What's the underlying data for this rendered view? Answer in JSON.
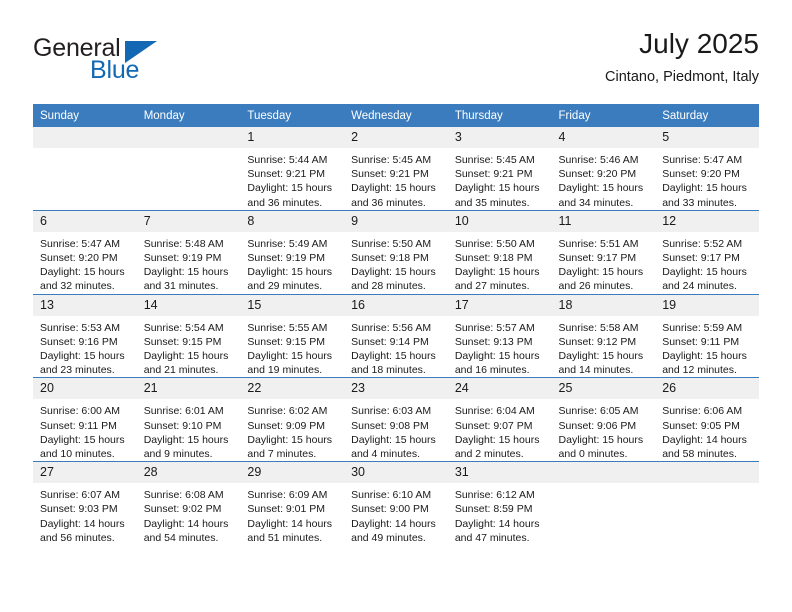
{
  "brand": {
    "name_part1": "General",
    "name_part2": "Blue",
    "accent_color": "#1268b3"
  },
  "header": {
    "title": "July 2025",
    "subtitle": "Cintano, Piedmont, Italy"
  },
  "calendar": {
    "header_color": "#3b7cbe",
    "daynum_band_color": "#f0f0f0",
    "weekday_headers": [
      "Sunday",
      "Monday",
      "Tuesday",
      "Wednesday",
      "Thursday",
      "Friday",
      "Saturday"
    ],
    "weeks": [
      [
        {
          "day": "",
          "lines": []
        },
        {
          "day": "",
          "lines": []
        },
        {
          "day": "1",
          "lines": [
            "Sunrise: 5:44 AM",
            "Sunset: 9:21 PM",
            "Daylight: 15 hours",
            "and 36 minutes."
          ]
        },
        {
          "day": "2",
          "lines": [
            "Sunrise: 5:45 AM",
            "Sunset: 9:21 PM",
            "Daylight: 15 hours",
            "and 36 minutes."
          ]
        },
        {
          "day": "3",
          "lines": [
            "Sunrise: 5:45 AM",
            "Sunset: 9:21 PM",
            "Daylight: 15 hours",
            "and 35 minutes."
          ]
        },
        {
          "day": "4",
          "lines": [
            "Sunrise: 5:46 AM",
            "Sunset: 9:20 PM",
            "Daylight: 15 hours",
            "and 34 minutes."
          ]
        },
        {
          "day": "5",
          "lines": [
            "Sunrise: 5:47 AM",
            "Sunset: 9:20 PM",
            "Daylight: 15 hours",
            "and 33 minutes."
          ]
        }
      ],
      [
        {
          "day": "6",
          "lines": [
            "Sunrise: 5:47 AM",
            "Sunset: 9:20 PM",
            "Daylight: 15 hours",
            "and 32 minutes."
          ]
        },
        {
          "day": "7",
          "lines": [
            "Sunrise: 5:48 AM",
            "Sunset: 9:19 PM",
            "Daylight: 15 hours",
            "and 31 minutes."
          ]
        },
        {
          "day": "8",
          "lines": [
            "Sunrise: 5:49 AM",
            "Sunset: 9:19 PM",
            "Daylight: 15 hours",
            "and 29 minutes."
          ]
        },
        {
          "day": "9",
          "lines": [
            "Sunrise: 5:50 AM",
            "Sunset: 9:18 PM",
            "Daylight: 15 hours",
            "and 28 minutes."
          ]
        },
        {
          "day": "10",
          "lines": [
            "Sunrise: 5:50 AM",
            "Sunset: 9:18 PM",
            "Daylight: 15 hours",
            "and 27 minutes."
          ]
        },
        {
          "day": "11",
          "lines": [
            "Sunrise: 5:51 AM",
            "Sunset: 9:17 PM",
            "Daylight: 15 hours",
            "and 26 minutes."
          ]
        },
        {
          "day": "12",
          "lines": [
            "Sunrise: 5:52 AM",
            "Sunset: 9:17 PM",
            "Daylight: 15 hours",
            "and 24 minutes."
          ]
        }
      ],
      [
        {
          "day": "13",
          "lines": [
            "Sunrise: 5:53 AM",
            "Sunset: 9:16 PM",
            "Daylight: 15 hours",
            "and 23 minutes."
          ]
        },
        {
          "day": "14",
          "lines": [
            "Sunrise: 5:54 AM",
            "Sunset: 9:15 PM",
            "Daylight: 15 hours",
            "and 21 minutes."
          ]
        },
        {
          "day": "15",
          "lines": [
            "Sunrise: 5:55 AM",
            "Sunset: 9:15 PM",
            "Daylight: 15 hours",
            "and 19 minutes."
          ]
        },
        {
          "day": "16",
          "lines": [
            "Sunrise: 5:56 AM",
            "Sunset: 9:14 PM",
            "Daylight: 15 hours",
            "and 18 minutes."
          ]
        },
        {
          "day": "17",
          "lines": [
            "Sunrise: 5:57 AM",
            "Sunset: 9:13 PM",
            "Daylight: 15 hours",
            "and 16 minutes."
          ]
        },
        {
          "day": "18",
          "lines": [
            "Sunrise: 5:58 AM",
            "Sunset: 9:12 PM",
            "Daylight: 15 hours",
            "and 14 minutes."
          ]
        },
        {
          "day": "19",
          "lines": [
            "Sunrise: 5:59 AM",
            "Sunset: 9:11 PM",
            "Daylight: 15 hours",
            "and 12 minutes."
          ]
        }
      ],
      [
        {
          "day": "20",
          "lines": [
            "Sunrise: 6:00 AM",
            "Sunset: 9:11 PM",
            "Daylight: 15 hours",
            "and 10 minutes."
          ]
        },
        {
          "day": "21",
          "lines": [
            "Sunrise: 6:01 AM",
            "Sunset: 9:10 PM",
            "Daylight: 15 hours",
            "and 9 minutes."
          ]
        },
        {
          "day": "22",
          "lines": [
            "Sunrise: 6:02 AM",
            "Sunset: 9:09 PM",
            "Daylight: 15 hours",
            "and 7 minutes."
          ]
        },
        {
          "day": "23",
          "lines": [
            "Sunrise: 6:03 AM",
            "Sunset: 9:08 PM",
            "Daylight: 15 hours",
            "and 4 minutes."
          ]
        },
        {
          "day": "24",
          "lines": [
            "Sunrise: 6:04 AM",
            "Sunset: 9:07 PM",
            "Daylight: 15 hours",
            "and 2 minutes."
          ]
        },
        {
          "day": "25",
          "lines": [
            "Sunrise: 6:05 AM",
            "Sunset: 9:06 PM",
            "Daylight: 15 hours",
            "and 0 minutes."
          ]
        },
        {
          "day": "26",
          "lines": [
            "Sunrise: 6:06 AM",
            "Sunset: 9:05 PM",
            "Daylight: 14 hours",
            "and 58 minutes."
          ]
        }
      ],
      [
        {
          "day": "27",
          "lines": [
            "Sunrise: 6:07 AM",
            "Sunset: 9:03 PM",
            "Daylight: 14 hours",
            "and 56 minutes."
          ]
        },
        {
          "day": "28",
          "lines": [
            "Sunrise: 6:08 AM",
            "Sunset: 9:02 PM",
            "Daylight: 14 hours",
            "and 54 minutes."
          ]
        },
        {
          "day": "29",
          "lines": [
            "Sunrise: 6:09 AM",
            "Sunset: 9:01 PM",
            "Daylight: 14 hours",
            "and 51 minutes."
          ]
        },
        {
          "day": "30",
          "lines": [
            "Sunrise: 6:10 AM",
            "Sunset: 9:00 PM",
            "Daylight: 14 hours",
            "and 49 minutes."
          ]
        },
        {
          "day": "31",
          "lines": [
            "Sunrise: 6:12 AM",
            "Sunset: 8:59 PM",
            "Daylight: 14 hours",
            "and 47 minutes."
          ]
        },
        {
          "day": "",
          "lines": []
        },
        {
          "day": "",
          "lines": []
        }
      ]
    ]
  }
}
